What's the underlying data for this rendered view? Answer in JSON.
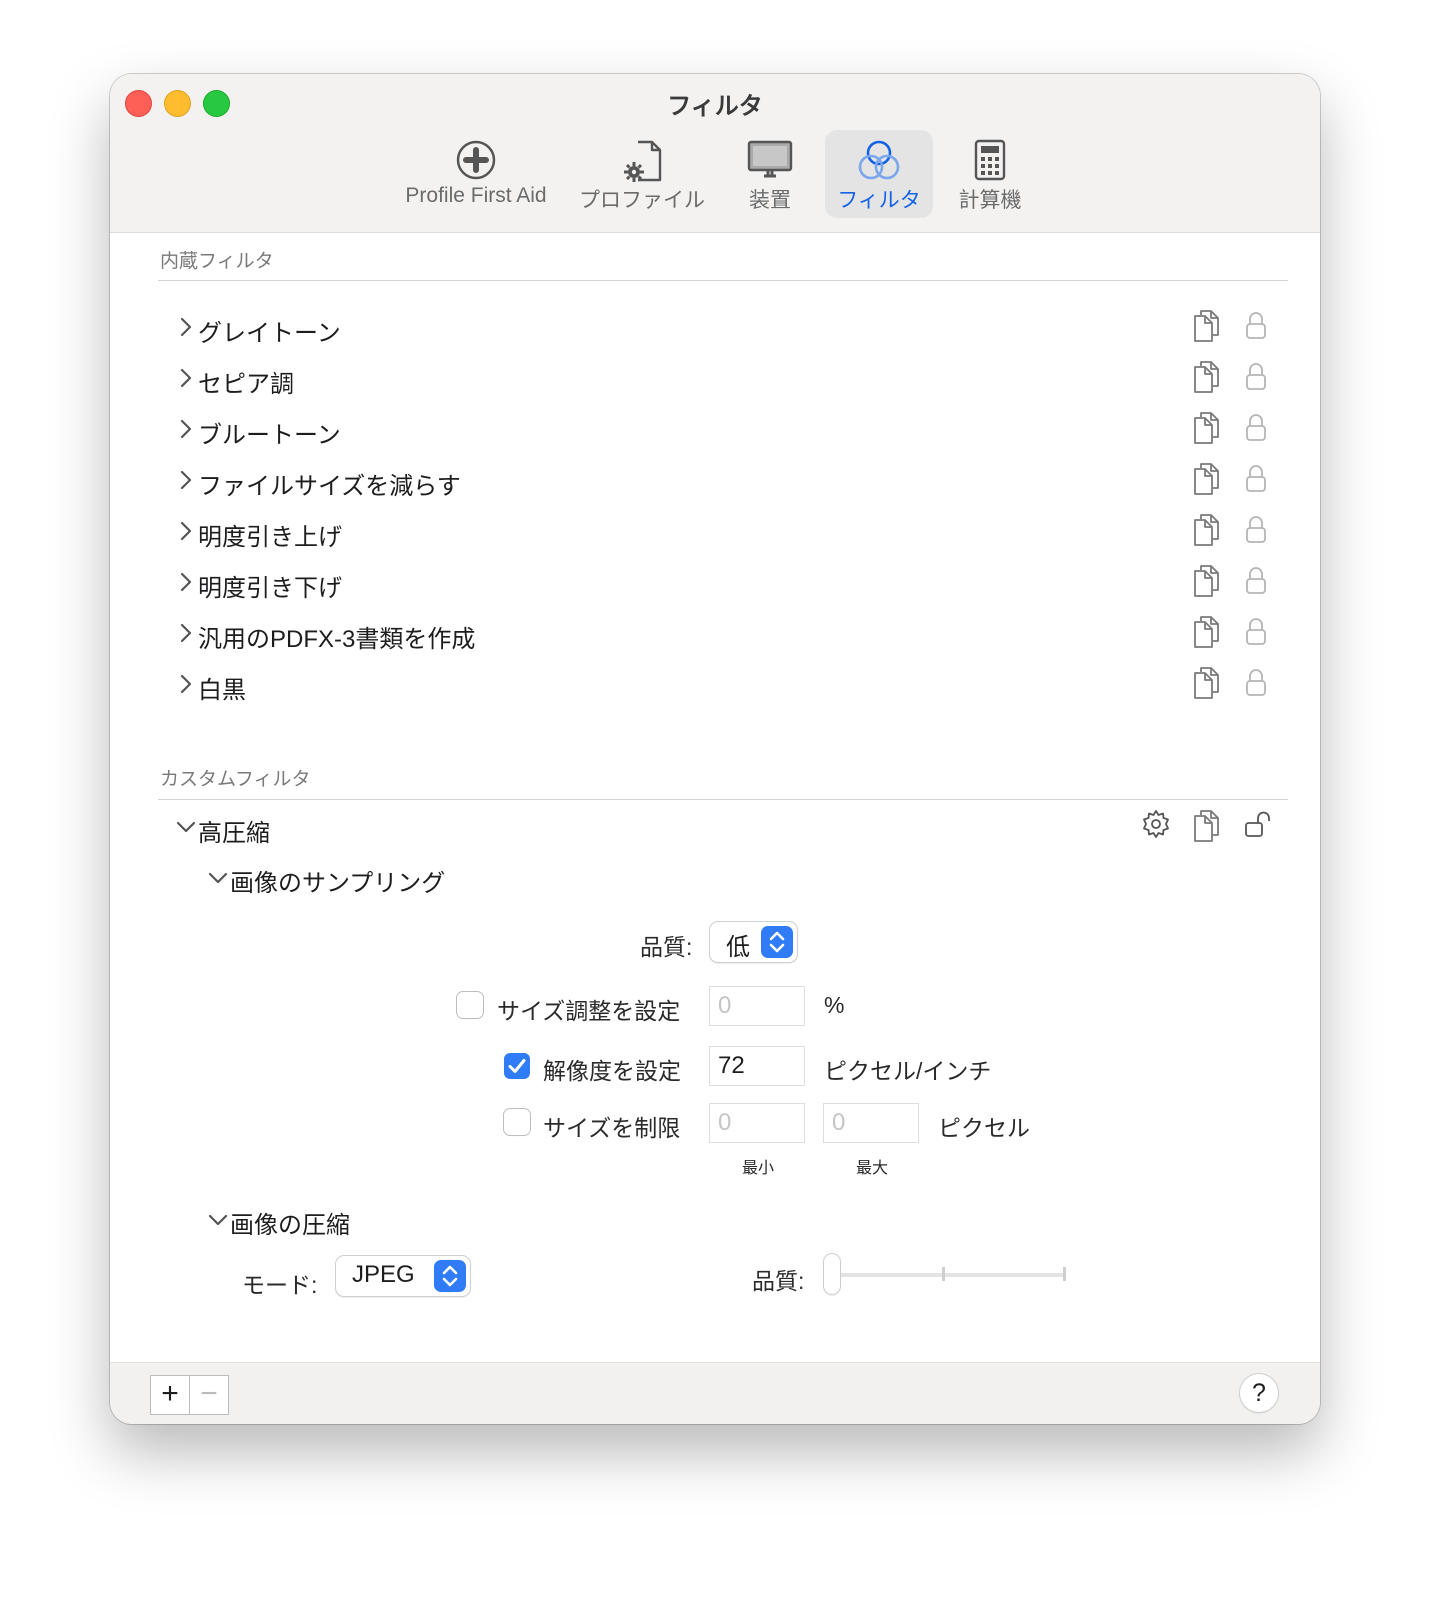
{
  "window": {
    "title": "フィルタ"
  },
  "toolbar": {
    "items": [
      {
        "label": "Profile First Aid",
        "icon": "first-aid-icon"
      },
      {
        "label": "プロファイル",
        "icon": "profile-document-gear-icon"
      },
      {
        "label": "装置",
        "icon": "display-icon"
      },
      {
        "label": "フィルタ",
        "icon": "filter-circles-icon",
        "selected": true
      },
      {
        "label": "計算機",
        "icon": "calculator-icon"
      }
    ]
  },
  "builtin": {
    "header": "内蔵フィルタ",
    "items": [
      {
        "name": "グレイトーン"
      },
      {
        "name": "セピア調"
      },
      {
        "name": "ブルートーン"
      },
      {
        "name": "ファイルサイズを減らす"
      },
      {
        "name": "明度引き上げ"
      },
      {
        "name": "明度引き下げ"
      },
      {
        "name": "汎用のPDFX-3書類を作成"
      },
      {
        "name": "白黒"
      }
    ]
  },
  "custom": {
    "header": "カスタムフィルタ",
    "filter_name": "高圧縮",
    "sampling": {
      "title": "画像のサンプリング",
      "quality_label": "品質:",
      "quality_value": "低",
      "resize_label": "サイズ調整を設定",
      "resize_checked": false,
      "resize_value": "0",
      "resize_unit": "%",
      "resolution_label": "解像度を設定",
      "resolution_checked": true,
      "resolution_value": "72",
      "resolution_unit": "ピクセル/インチ",
      "limit_label": "サイズを制限",
      "limit_checked": false,
      "limit_min": "0",
      "limit_max": "0",
      "limit_unit": "ピクセル",
      "min_label": "最小",
      "max_label": "最大"
    },
    "compression": {
      "title": "画像の圧縮",
      "mode_label": "モード:",
      "mode_value": "JPEG",
      "quality_label": "品質:",
      "quality_level": 0
    }
  },
  "footer": {
    "add": "+",
    "remove": "−",
    "help": "?"
  },
  "colors": {
    "accent": "#2f7cf6",
    "selected_label": "#1463e6",
    "close": "#fe5f57",
    "minimize": "#febc2e",
    "zoom": "#28c840"
  }
}
